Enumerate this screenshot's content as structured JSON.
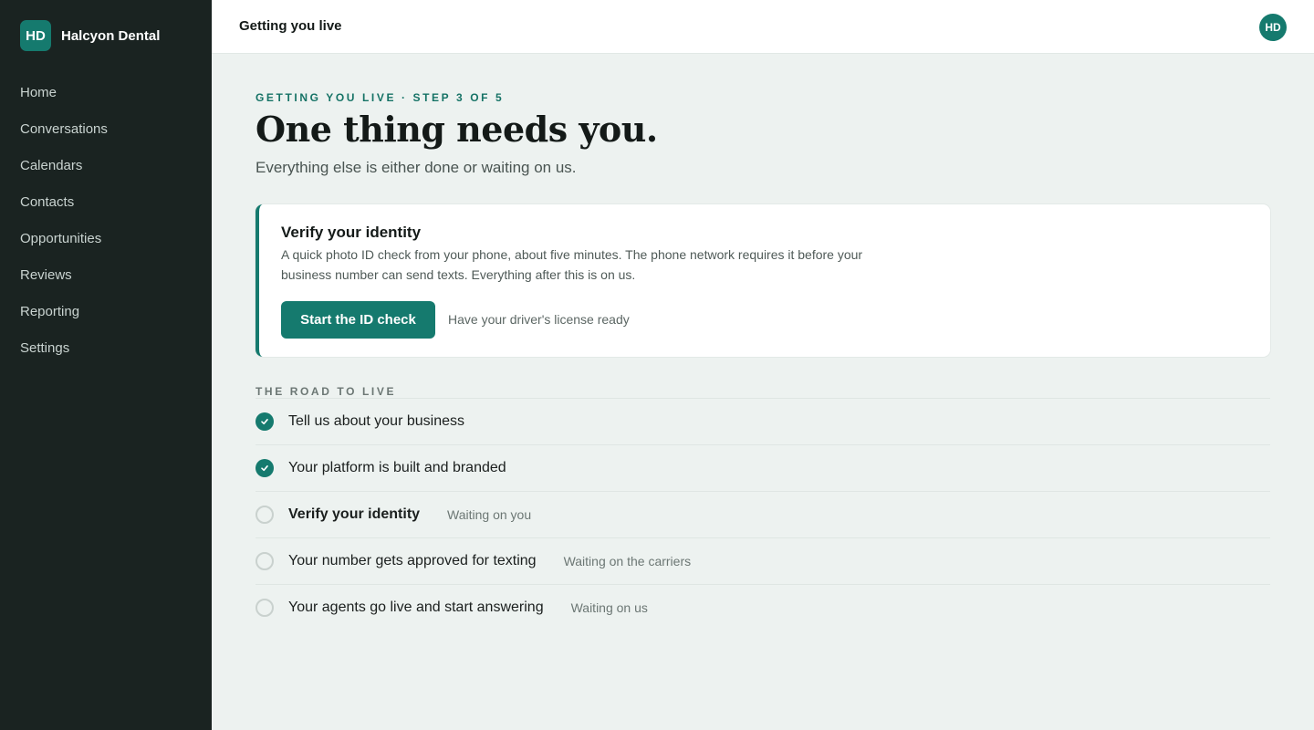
{
  "brand": {
    "initials": "HD",
    "name": "Halcyon Dental"
  },
  "nav": {
    "items": [
      {
        "label": "Home"
      },
      {
        "label": "Conversations"
      },
      {
        "label": "Calendars"
      },
      {
        "label": "Contacts"
      },
      {
        "label": "Opportunities"
      },
      {
        "label": "Reviews"
      },
      {
        "label": "Reporting"
      },
      {
        "label": "Settings"
      }
    ]
  },
  "header": {
    "title": "Getting you live",
    "avatar_initials": "HD"
  },
  "main": {
    "eyebrow": "GETTING YOU LIVE · STEP 3 OF 5",
    "headline": "One thing needs you.",
    "subhead": "Everything else is either done or waiting on us.",
    "card": {
      "title": "Verify your identity",
      "description": "A quick photo ID check from your phone, about five minutes. The phone network requires it before your business number can send texts. Everything after this is on us.",
      "button_label": "Start the ID check",
      "hint": "Have your driver's license ready"
    },
    "road_label": "THE ROAD TO LIVE",
    "steps": [
      {
        "label": "Tell us about your business",
        "status": "",
        "state": "done"
      },
      {
        "label": "Your platform is built and branded",
        "status": "",
        "state": "done"
      },
      {
        "label": "Verify your identity",
        "status": "Waiting on you",
        "state": "current"
      },
      {
        "label": "Your number gets approved for texting",
        "status": "Waiting on the carriers",
        "state": "pending"
      },
      {
        "label": "Your agents go live and start answering",
        "status": "Waiting on us",
        "state": "pending"
      }
    ]
  },
  "colors": {
    "accent": "#157a6e",
    "sidebar_bg": "#1a2321",
    "page_bg": "#edf2f0"
  },
  "icons": {
    "done": "check-circle-icon",
    "pending": "empty-circle-icon"
  }
}
